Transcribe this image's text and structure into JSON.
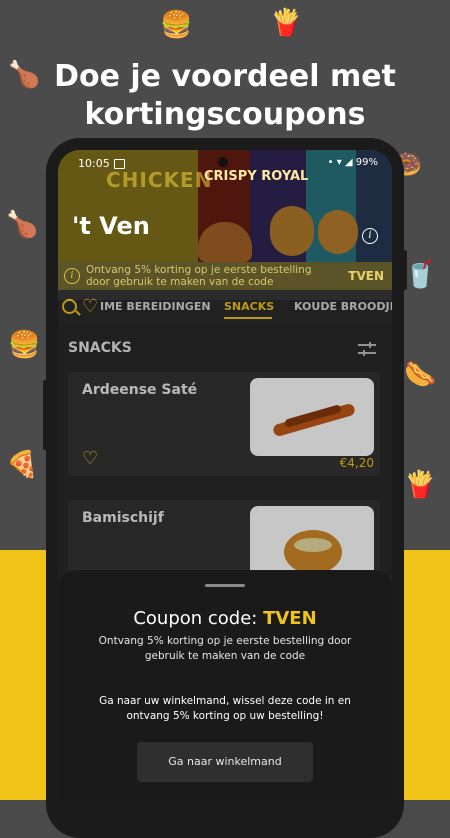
{
  "headline": {
    "line1": "Doe je voordeel met",
    "line2": "kortingscoupons"
  },
  "status_bar": {
    "time": "10:05",
    "right": "•  ▾ ◢ 99%"
  },
  "hero": {
    "word1": "CHICKEN",
    "word2": "CRISPY ROYAL",
    "store_name": "'t Ven"
  },
  "coupon_strip": {
    "text": "Ontvang 5% korting op je eerste bestelling door gebruik te maken van de code",
    "code": "TVEN"
  },
  "tabs": [
    {
      "label": "IME BEREIDINGEN",
      "active": false
    },
    {
      "label": "SNACKS",
      "active": true
    },
    {
      "label": "KOUDE BROODJES",
      "active": false
    }
  ],
  "section": {
    "title": "SNACKS"
  },
  "products": [
    {
      "name": "Ardeense Saté",
      "price": "€4,20"
    },
    {
      "name": "Bamischijf",
      "price": ""
    }
  ],
  "sheet": {
    "title_prefix": "Coupon code: ",
    "code": "TVEN",
    "subtitle": "Ontvang 5% korting op je eerste bestelling door gebruik te maken van de code",
    "description": "Ga naar uw winkelmand, wissel deze code in en ontvang 5% korting op uw bestelling!",
    "button": "Ga naar winkelmand"
  },
  "colors": {
    "accent": "#f0c419",
    "sheet_bg": "#1a1a1a",
    "phone_bg": "#1b1b1b"
  }
}
